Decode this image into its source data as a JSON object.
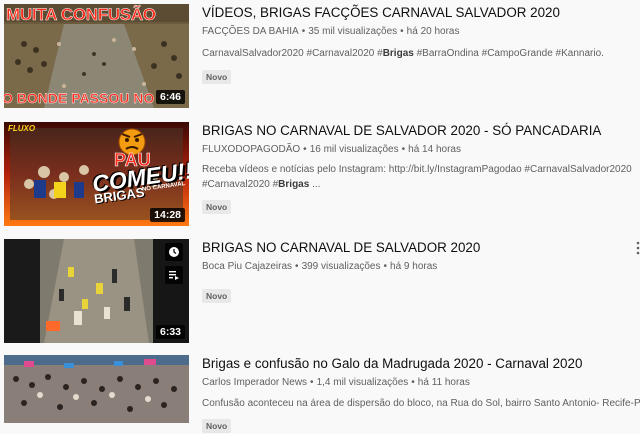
{
  "results": [
    {
      "title": "VÍDEOS, BRIGAS FACÇÕES CARNAVAL SALVADOR 2020",
      "channel": "FACÇÕES DA BAHIA",
      "views": "35 mil visualizações",
      "age": "há 20 horas",
      "desc_pre": "CarnavalSalvador2020 #Carnaval2020 #",
      "desc_bold": "Brigas",
      "desc_post": " #BarraOndina #CampoGrande #Kannario.",
      "badge": "Novo",
      "duration": "6:46",
      "thumb_top_text": "MUITA CONFUSÃO",
      "thumb_bottom_text": "O BONDE PASSOU NO"
    },
    {
      "title": "BRIGAS NO CARNAVAL DE SALVADOR 2020 - SÓ PANCADARIA",
      "channel": "FLUXODOPAGODÃO",
      "views": "16 mil visualizações",
      "age": "há 14 horas",
      "desc_line1": "Receba vídeos e notícias pelo Instagram: http://bit.ly/InstagramPagodao #CarnavalSalvador2020",
      "desc_pre": "#Carnaval2020 #",
      "desc_bold": "Brigas",
      "desc_post": " ...",
      "badge": "Novo",
      "duration": "14:28",
      "thumb_text_big": "COMEU!!",
      "thumb_text_small": "BRIGAS",
      "thumb_text_tiny": "NO CARNAVAL",
      "thumb_logo": "FLUXO"
    },
    {
      "title": "BRIGAS NO CARNAVAL DE SALVADOR 2020",
      "channel": "Boca Piu Cajazeiras",
      "views": "399 visualizações",
      "age": "há 9 horas",
      "badge": "Novo",
      "duration": "6:33"
    },
    {
      "title": "Brigas e confusão no Galo da Madrugada 2020 - Carnaval 2020",
      "channel": "Carlos Imperador News",
      "views": "1,4 mil visualizações",
      "age": "há 11 horas",
      "desc_line1": "Confusão aconteceu na área de dispersão do bloco, na Rua do Sol, bairro Santo Antonio- Recife-Pe.",
      "badge": "Novo"
    }
  ],
  "separator": "•",
  "colors": {
    "title": "#0f0f0f",
    "meta": "#606060",
    "background": "#f9f9f9",
    "badge_bg": "#e8e8e8"
  }
}
